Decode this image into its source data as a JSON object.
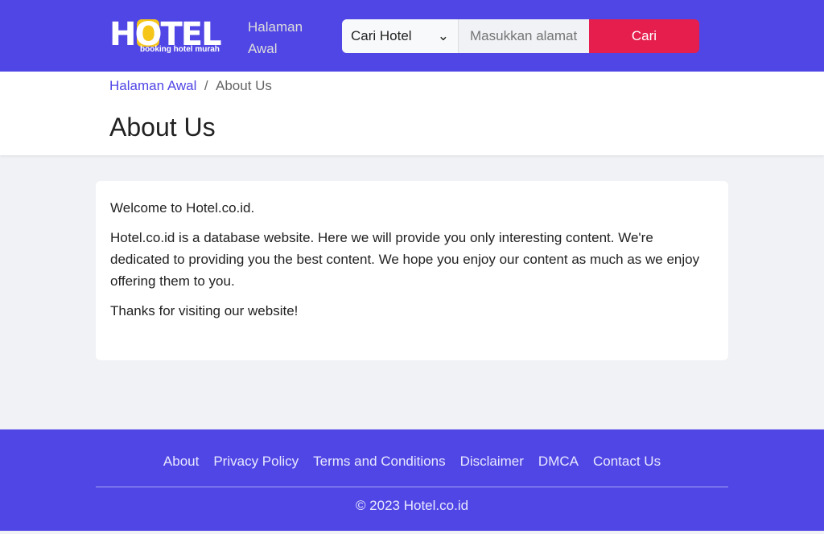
{
  "header": {
    "logo_text": "HOTEL",
    "logo_tagline": "booking hotel murah",
    "home_link": "Halaman Awal",
    "search_select": "Cari Hotel",
    "search_placeholder": "Masukkan alamat",
    "search_button": "Cari"
  },
  "breadcrumb": {
    "home": "Halaman Awal",
    "separator": "/",
    "current": "About Us"
  },
  "page_title": "About Us",
  "content": {
    "paragraphs": [
      "Welcome to Hotel.co.id.",
      "Hotel.co.id is a database website. Here we will provide you only interesting content. We're dedicated to providing you the best content. We hope you enjoy our content as much as we enjoy offering them to you.",
      "Thanks for visiting our website!"
    ]
  },
  "footer": {
    "links": [
      "About",
      "Privacy Policy",
      "Terms and Conditions",
      "Disclaimer",
      "DMCA",
      "Contact Us"
    ],
    "copyright": "© 2023 Hotel.co.id"
  },
  "colors": {
    "brand": "#5046e5",
    "accent": "#e61e4d"
  }
}
